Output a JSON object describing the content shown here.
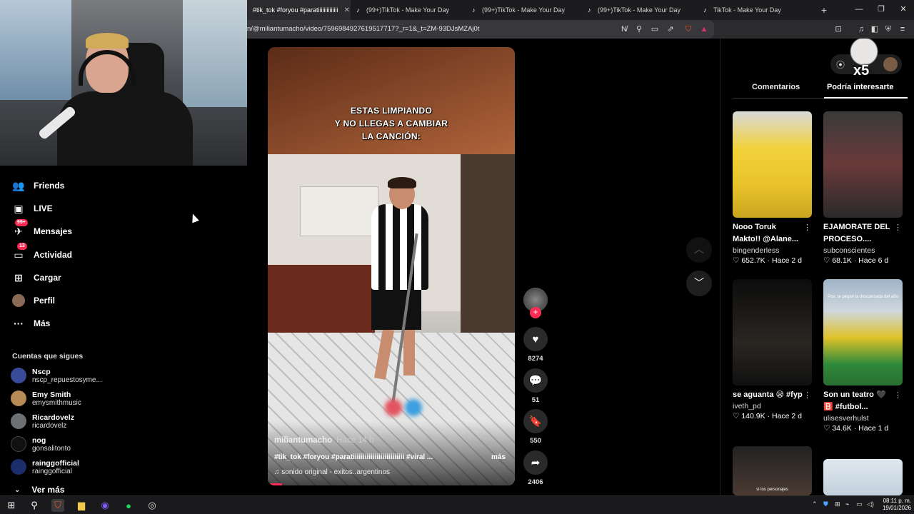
{
  "browser": {
    "tabs": [
      {
        "label": "#tik_tok #foryou #paratiiiiiiiiiiiiii",
        "active": true
      },
      {
        "label": "(99+)TikTok - Make Your Day",
        "active": false
      },
      {
        "label": "(99+)TikTok - Make Your Day",
        "active": false
      },
      {
        "label": "(99+)TikTok - Make Your Day",
        "active": false
      },
      {
        "label": "TikTok - Make Your Day",
        "active": false
      }
    ],
    "new_tab": "+",
    "url": "n/@miliantumacho/video/7596984927619517717?_r=1&_t=ZM-93DJsMZAj0t"
  },
  "sidebar": {
    "items": [
      {
        "label": "Friends",
        "icon": "friends-icon"
      },
      {
        "label": "LIVE",
        "icon": "live-icon"
      },
      {
        "label": "Mensajes",
        "icon": "messages-icon",
        "badge": "99+"
      },
      {
        "label": "Actividad",
        "icon": "activity-icon",
        "badge": "13"
      },
      {
        "label": "Cargar",
        "icon": "upload-icon"
      },
      {
        "label": "Perfil",
        "icon": "profile-icon"
      },
      {
        "label": "Más",
        "icon": "more-icon"
      }
    ],
    "following_title": "Cuentas que sigues",
    "following": [
      {
        "name": "Nscp",
        "handle": "nscp_repuestosyme..."
      },
      {
        "name": "Emy Smith",
        "handle": "emysmithmusic"
      },
      {
        "name": "Ricardovelz",
        "handle": "ricardovelz"
      },
      {
        "name": "nog",
        "handle": "gonsalitonto"
      },
      {
        "name": "rainggofficial",
        "handle": "rainggofficial"
      }
    ],
    "see_more": "Ver más"
  },
  "video": {
    "caption_lines": [
      "ESTAS LIMPIANDO",
      "Y NO LLEGAS A CAMBIAR",
      "LA CANCIÓN:"
    ],
    "author": "miliantumacho",
    "time_ago": "Hace 14 h",
    "description": "#tik_tok #foryou #paratiiiiiiiiiiiiiiiiiiiiiiiiii #viral ...",
    "more": "más",
    "sound": "sonido original - exitos..argentinos"
  },
  "actions": {
    "follow_plus": "+",
    "likes": "8274",
    "comments": "51",
    "saves": "550",
    "shares": "2406"
  },
  "right_panel": {
    "tab_comments": "Comentarios",
    "tab_suggested": "Podría interesarte",
    "overlay_text": "x5",
    "cards": [
      {
        "title": "Nooo Toruk Makto!! @Alane...",
        "author": "bingenderless",
        "likes": "652.7K",
        "time": "Hace 2 d"
      },
      {
        "title": "EJAMORATE DEL PROCESO....",
        "author": "subconscientes",
        "likes": "68.1K",
        "time": "Hace 6 d"
      },
      {
        "title": "se aguanta 😪 #fyp",
        "author": "iveth_pd",
        "likes": "140.9K",
        "time": "Hace 2 d"
      },
      {
        "title": "Son un teatro 🖤 🅱️ #futbol...",
        "author": "ulisesverhulst",
        "likes": "34.6K",
        "time": "Hace 1 d"
      }
    ],
    "thumb_texts": [
      "Pov: te pegan la descansada del año",
      "si los personajes"
    ]
  },
  "taskbar": {
    "time": "08:11 p. m.",
    "date": "19/01/2026"
  }
}
